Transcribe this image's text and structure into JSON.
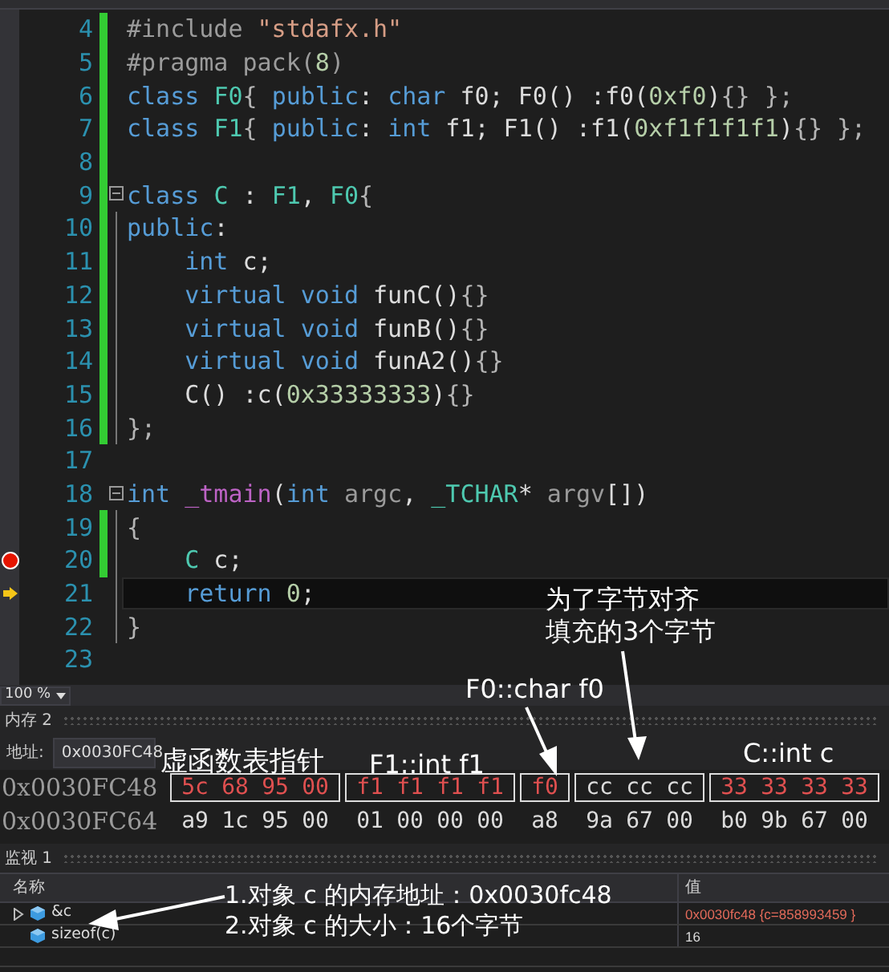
{
  "editor": {
    "lines": [
      {
        "number": "4",
        "changed": true,
        "collapsible": false,
        "outlined": false,
        "breakpoint": false,
        "current": false,
        "tokens": [
          {
            "kind": "preproc",
            "text": "#include "
          },
          {
            "kind": "string",
            "text": "\"stdafx.h\""
          }
        ]
      },
      {
        "number": "5",
        "changed": true,
        "collapsible": false,
        "outlined": false,
        "breakpoint": false,
        "current": false,
        "tokens": [
          {
            "kind": "preproc",
            "text": "#pragma pack("
          },
          {
            "kind": "number",
            "text": "8"
          },
          {
            "kind": "preproc",
            "text": ")"
          }
        ]
      },
      {
        "number": "6",
        "changed": true,
        "collapsible": false,
        "outlined": false,
        "breakpoint": false,
        "current": false,
        "tokens": [
          {
            "kind": "keyword",
            "text": "class "
          },
          {
            "kind": "type",
            "text": "F0"
          },
          {
            "kind": "punct",
            "text": "{ "
          },
          {
            "kind": "keyword",
            "text": "public"
          },
          {
            "kind": "plain",
            "text": ": "
          },
          {
            "kind": "keyword",
            "text": "char"
          },
          {
            "kind": "plain",
            "text": " f0; F0() :f0("
          },
          {
            "kind": "number",
            "text": "0xf0"
          },
          {
            "kind": "plain",
            "text": ")"
          },
          {
            "kind": "punct",
            "text": "{} };"
          }
        ]
      },
      {
        "number": "7",
        "changed": true,
        "collapsible": false,
        "outlined": false,
        "breakpoint": false,
        "current": false,
        "tokens": [
          {
            "kind": "keyword",
            "text": "class "
          },
          {
            "kind": "type",
            "text": "F1"
          },
          {
            "kind": "punct",
            "text": "{ "
          },
          {
            "kind": "keyword",
            "text": "public"
          },
          {
            "kind": "plain",
            "text": ": "
          },
          {
            "kind": "keyword",
            "text": "int"
          },
          {
            "kind": "plain",
            "text": " f1; F1() :f1("
          },
          {
            "kind": "number",
            "text": "0xf1f1f1f1"
          },
          {
            "kind": "plain",
            "text": ")"
          },
          {
            "kind": "punct",
            "text": "{} };"
          }
        ]
      },
      {
        "number": "8",
        "changed": true,
        "collapsible": false,
        "outlined": false,
        "breakpoint": false,
        "current": false
      },
      {
        "number": "9",
        "changed": true,
        "collapsible": true,
        "outlined": false,
        "breakpoint": false,
        "current": false,
        "tokens": [
          {
            "kind": "keyword",
            "text": "class "
          },
          {
            "kind": "type",
            "text": "C"
          },
          {
            "kind": "plain",
            "text": " : "
          },
          {
            "kind": "type",
            "text": "F1"
          },
          {
            "kind": "plain",
            "text": ", "
          },
          {
            "kind": "type",
            "text": "F0"
          },
          {
            "kind": "punct",
            "text": "{"
          }
        ]
      },
      {
        "number": "10",
        "changed": true,
        "collapsible": false,
        "outlined": true,
        "breakpoint": false,
        "current": false,
        "tokens": [
          {
            "kind": "keyword",
            "text": "public"
          },
          {
            "kind": "plain",
            "text": ":"
          }
        ]
      },
      {
        "number": "11",
        "changed": true,
        "collapsible": false,
        "outlined": true,
        "breakpoint": false,
        "current": false,
        "tokens": [
          {
            "kind": "keyword",
            "text": "    int"
          },
          {
            "kind": "plain",
            "text": " c;"
          }
        ]
      },
      {
        "number": "12",
        "changed": true,
        "collapsible": false,
        "outlined": true,
        "breakpoint": false,
        "current": false,
        "tokens": [
          {
            "kind": "keyword",
            "text": "    virtual void"
          },
          {
            "kind": "plain",
            "text": " funC()"
          },
          {
            "kind": "punct",
            "text": "{}"
          }
        ]
      },
      {
        "number": "13",
        "changed": true,
        "collapsible": false,
        "outlined": true,
        "breakpoint": false,
        "current": false,
        "tokens": [
          {
            "kind": "keyword",
            "text": "    virtual void"
          },
          {
            "kind": "plain",
            "text": " funB()"
          },
          {
            "kind": "punct",
            "text": "{}"
          }
        ]
      },
      {
        "number": "14",
        "changed": true,
        "collapsible": false,
        "outlined": true,
        "breakpoint": false,
        "current": false,
        "tokens": [
          {
            "kind": "keyword",
            "text": "    virtual void"
          },
          {
            "kind": "plain",
            "text": " funA2()"
          },
          {
            "kind": "punct",
            "text": "{}"
          }
        ]
      },
      {
        "number": "15",
        "changed": true,
        "collapsible": false,
        "outlined": true,
        "breakpoint": false,
        "current": false,
        "tokens": [
          {
            "kind": "plain",
            "text": "    C() :c("
          },
          {
            "kind": "number",
            "text": "0x33333333"
          },
          {
            "kind": "plain",
            "text": ")"
          },
          {
            "kind": "punct",
            "text": "{}"
          }
        ]
      },
      {
        "number": "16",
        "changed": true,
        "collapsible": false,
        "outlined": true,
        "breakpoint": false,
        "current": false,
        "tokens": [
          {
            "kind": "punct",
            "text": "};"
          }
        ]
      },
      {
        "number": "17",
        "changed": false,
        "collapsible": false,
        "outlined": false,
        "breakpoint": false,
        "current": false
      },
      {
        "number": "18",
        "changed": false,
        "collapsible": true,
        "outlined": false,
        "breakpoint": false,
        "current": false,
        "tokens": [
          {
            "kind": "keyword",
            "text": "int "
          },
          {
            "kind": "function",
            "text": "_tmain"
          },
          {
            "kind": "plain",
            "text": "("
          },
          {
            "kind": "keyword",
            "text": "int"
          },
          {
            "kind": "param",
            "text": " argc"
          },
          {
            "kind": "plain",
            "text": ", "
          },
          {
            "kind": "type",
            "text": "_TCHAR"
          },
          {
            "kind": "plain",
            "text": "* "
          },
          {
            "kind": "param",
            "text": "argv"
          },
          {
            "kind": "plain",
            "text": "[])"
          }
        ]
      },
      {
        "number": "19",
        "changed": true,
        "collapsible": false,
        "outlined": true,
        "breakpoint": false,
        "current": false,
        "tokens": [
          {
            "kind": "punct",
            "text": "{"
          }
        ]
      },
      {
        "number": "20",
        "changed": true,
        "collapsible": false,
        "outlined": true,
        "breakpoint": true,
        "current": false,
        "tokens": [
          {
            "kind": "type",
            "text": "    C"
          },
          {
            "kind": "plain",
            "text": " c;"
          }
        ]
      },
      {
        "number": "21",
        "changed": false,
        "collapsible": false,
        "outlined": true,
        "breakpoint": false,
        "current": true,
        "tokens": [
          {
            "kind": "keyword",
            "text": "    return "
          },
          {
            "kind": "number",
            "text": "0"
          },
          {
            "kind": "plain",
            "text": ";"
          }
        ]
      },
      {
        "number": "22",
        "changed": false,
        "collapsible": false,
        "outlined": true,
        "breakpoint": false,
        "current": false,
        "tokens": [
          {
            "kind": "punct",
            "text": "}"
          }
        ]
      },
      {
        "number": "23",
        "changed": false,
        "collapsible": false,
        "outlined": false,
        "breakpoint": false,
        "current": false
      }
    ]
  },
  "zoom": {
    "value": "100 %"
  },
  "memory": {
    "title": "内存 2",
    "address_label": "地址:",
    "address": "0x0030FC48",
    "rows": [
      {
        "address": "0x0030FC48",
        "groups": [
          {
            "bytes": [
              {
                "text": "5c",
                "changed": true
              },
              {
                "text": "68",
                "changed": true
              },
              {
                "text": "95",
                "changed": true
              },
              {
                "text": "00",
                "changed": true
              }
            ]
          },
          {
            "bytes": [
              {
                "text": "f1",
                "changed": true
              },
              {
                "text": "f1",
                "changed": true
              },
              {
                "text": "f1",
                "changed": true
              },
              {
                "text": "f1",
                "changed": true
              }
            ]
          },
          {
            "bytes": [
              {
                "text": "f0",
                "changed": true
              }
            ]
          },
          {
            "bytes": [
              {
                "text": "cc",
                "changed": false
              },
              {
                "text": "cc",
                "changed": false
              },
              {
                "text": "cc",
                "changed": false
              }
            ]
          },
          {
            "bytes": [
              {
                "text": "33",
                "changed": true
              },
              {
                "text": "33",
                "changed": true
              },
              {
                "text": "33",
                "changed": true
              },
              {
                "text": "33",
                "changed": true
              }
            ]
          }
        ]
      },
      {
        "address": "0x0030FC64",
        "bytes": [
          {
            "text": "a9",
            "changed": false
          },
          {
            "text": "1c",
            "changed": false
          },
          {
            "text": "95",
            "changed": false
          },
          {
            "text": "00",
            "changed": false
          },
          {
            "text": "01",
            "changed": false
          },
          {
            "text": "00",
            "changed": false
          },
          {
            "text": "00",
            "changed": false
          },
          {
            "text": "00",
            "changed": false
          },
          {
            "text": "a8",
            "changed": false
          },
          {
            "text": "9a",
            "changed": false
          },
          {
            "text": "67",
            "changed": false
          },
          {
            "text": "00",
            "changed": false
          },
          {
            "text": "b0",
            "changed": false
          },
          {
            "text": "9b",
            "changed": false
          },
          {
            "text": "67",
            "changed": false
          },
          {
            "text": "00",
            "changed": false
          }
        ]
      }
    ]
  },
  "watch": {
    "title": "监视 1",
    "columns": [
      "名称",
      "值"
    ],
    "rows": [
      {
        "name": "&c",
        "expandable": true,
        "value": "0x0030fc48 {c=858993459 }",
        "changed": true
      },
      {
        "name": "sizeof(c)",
        "expandable": false,
        "value": "16",
        "changed": false
      }
    ]
  },
  "annotations": [
    {
      "lines": [
        "为了字节对齐",
        "填充的3个字节"
      ]
    },
    {
      "lines": [
        "F0::char f0"
      ]
    },
    {
      "lines": [
        "虚函数表指针"
      ]
    },
    {
      "lines": [
        "F1::int f1"
      ]
    },
    {
      "lines": [
        "C::int c"
      ]
    },
    {
      "lines": [
        "1.对象 c 的内存地址：0x0030fc48"
      ]
    },
    {
      "lines": [
        "2.对象 c 的大小：16个字节"
      ]
    }
  ]
}
